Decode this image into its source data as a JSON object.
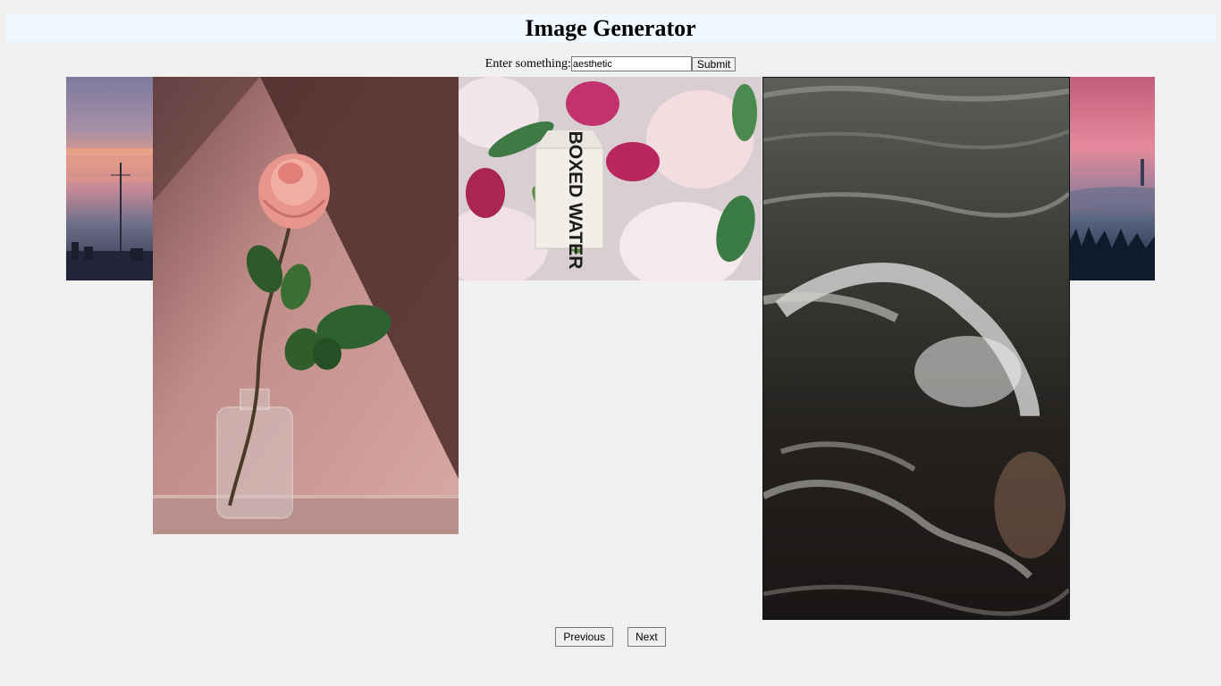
{
  "header": {
    "title": "Image Generator"
  },
  "search": {
    "label": "Enter something:",
    "value": "aesthetic",
    "submit_label": "Submit"
  },
  "gallery": {
    "images": [
      {
        "name": "sunset-sky-photo",
        "subject": "sunset sky with power pylon"
      },
      {
        "name": "rose-vase-photo",
        "subject": "pink rose in glass vase"
      },
      {
        "name": "flowers-carton-photo",
        "subject": "flowers with water carton"
      },
      {
        "name": "ocean-waves-photo",
        "subject": "ocean waves"
      },
      {
        "name": "pink-forest-photo",
        "subject": "pink sky over snowy forest"
      }
    ],
    "carton_text": "BOXED WATER"
  },
  "nav": {
    "previous_label": "Previous",
    "next_label": "Next"
  }
}
